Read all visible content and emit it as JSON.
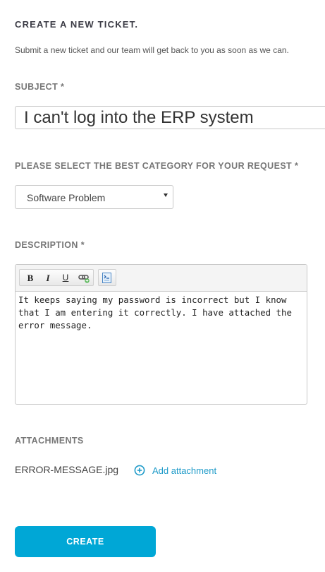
{
  "header": {
    "title": "CREATE A NEW TICKET.",
    "subtitle": "Submit a new ticket and our team will get back to you as soon as we can."
  },
  "subject": {
    "label": "SUBJECT *",
    "value": "I can't log into the ERP system"
  },
  "category": {
    "label": "PLEASE SELECT THE BEST CATEGORY FOR YOUR REQUEST *",
    "selected": "Software Problem"
  },
  "description": {
    "label": "DESCRIPTION *",
    "toolbar": {
      "bold": "B",
      "italic": "I",
      "underline": "U",
      "link_icon": "link-icon",
      "source_icon": "source-icon"
    },
    "body": "It keeps saying my password is incorrect but I know that I am entering it correctly. I have attached the error message."
  },
  "attachments": {
    "label": "ATTACHMENTS",
    "file_name": "ERROR-MESSAGE.jpg",
    "add_label": "Add attachment",
    "add_icon": "plus-circle-icon"
  },
  "actions": {
    "create_label": "CREATE"
  },
  "colors": {
    "accent": "#00a7d6",
    "link": "#1f9bc9"
  }
}
